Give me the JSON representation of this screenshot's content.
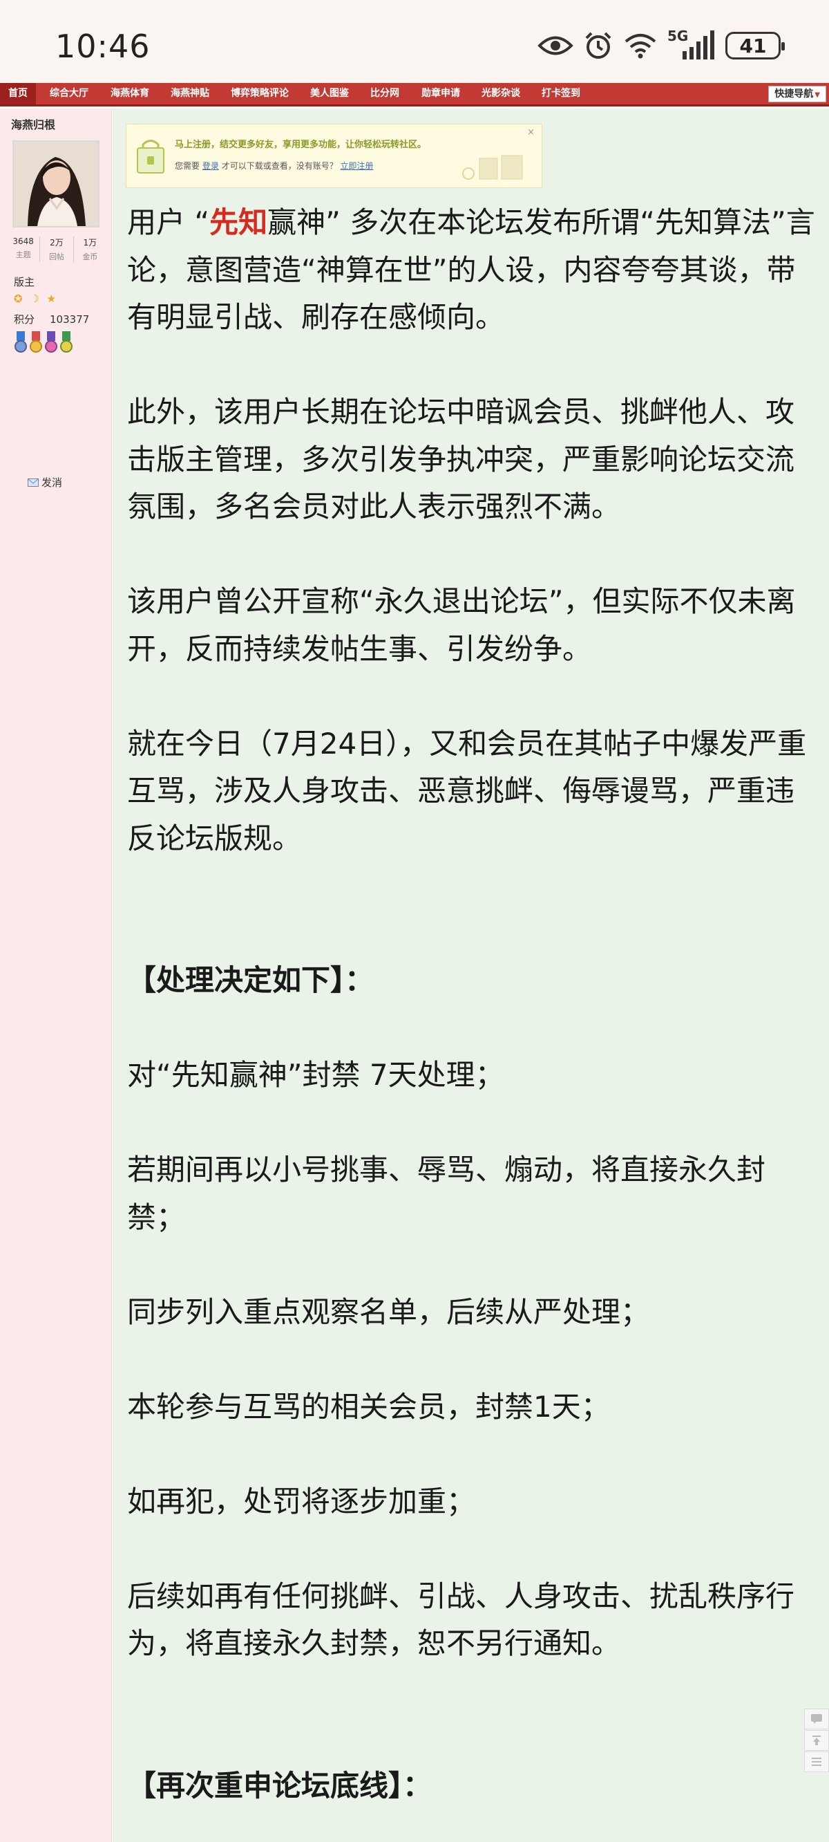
{
  "status_bar": {
    "time": "10:46",
    "network": "5G",
    "battery": "41"
  },
  "nav": {
    "items": [
      "首页",
      "综合大厅",
      "海燕体育",
      "海燕神贴",
      "博弈策略评论",
      "美人图鉴",
      "比分网",
      "勋章申请",
      "光影杂谈",
      "打卡签到"
    ],
    "quick_nav": "快捷导航"
  },
  "profile": {
    "name": "海燕归根",
    "stats": [
      {
        "value": "3648",
        "label": "主题"
      },
      {
        "value": "2万",
        "label": "回帖"
      },
      {
        "value": "1万",
        "label": "金币"
      }
    ],
    "role": "版主",
    "stars": "✪ ☽ ★",
    "points_label": "积分",
    "points_value": "103377",
    "pm_label": "发消"
  },
  "notice": {
    "title": "马上注册，结交更多好友，享用更多功能，让你轻松玩转社区。",
    "text_before": "您需要",
    "login": "登录",
    "text_middle": "才可以下载或查看，没有账号？",
    "register": "立即注册",
    "close": "×"
  },
  "post": {
    "p1_a": "用户 “",
    "p1_name": "先知",
    "p1_b": "赢神” 多次在本论坛发布所谓“先知算法”言论，意图营造“神算在世”的人设，内容夸夸其谈，带有明显引战、刷存在感倾向。",
    "p2": "此外，该用户长期在论坛中暗讽会员、挑衅他人、攻击版主管理，多次引发争执冲突，严重影响论坛交流氛围，多名会员对此人表示强烈不满。",
    "p3": "该用户曾公开宣称“永久退出论坛”，但实际不仅未离开，反而持续发帖生事、引发纷争。",
    "p4": "就在今日（7月24日），又和会员在其帖子中爆发严重互骂，涉及人身攻击、恶意挑衅、侮辱谩骂，严重违反论坛版规。",
    "h1": "【处理决定如下】：",
    "d1": "对“先知赢神”封禁 7天处理；",
    "d2": "若期间再以小号挑事、辱骂、煽动，将直接永久封禁；",
    "d3": "同步列入重点观察名单，后续从严处理；",
    "d4": "本轮参与互骂的相关会员，封禁1天；",
    "d5": "如再犯，处罚将逐步加重；",
    "d6": "后续如再有任何挑衅、引战、人身攻击、扰乱秩序行为，将直接永久封禁，恕不另行通知。",
    "h2": "【再次重申论坛底线】："
  }
}
